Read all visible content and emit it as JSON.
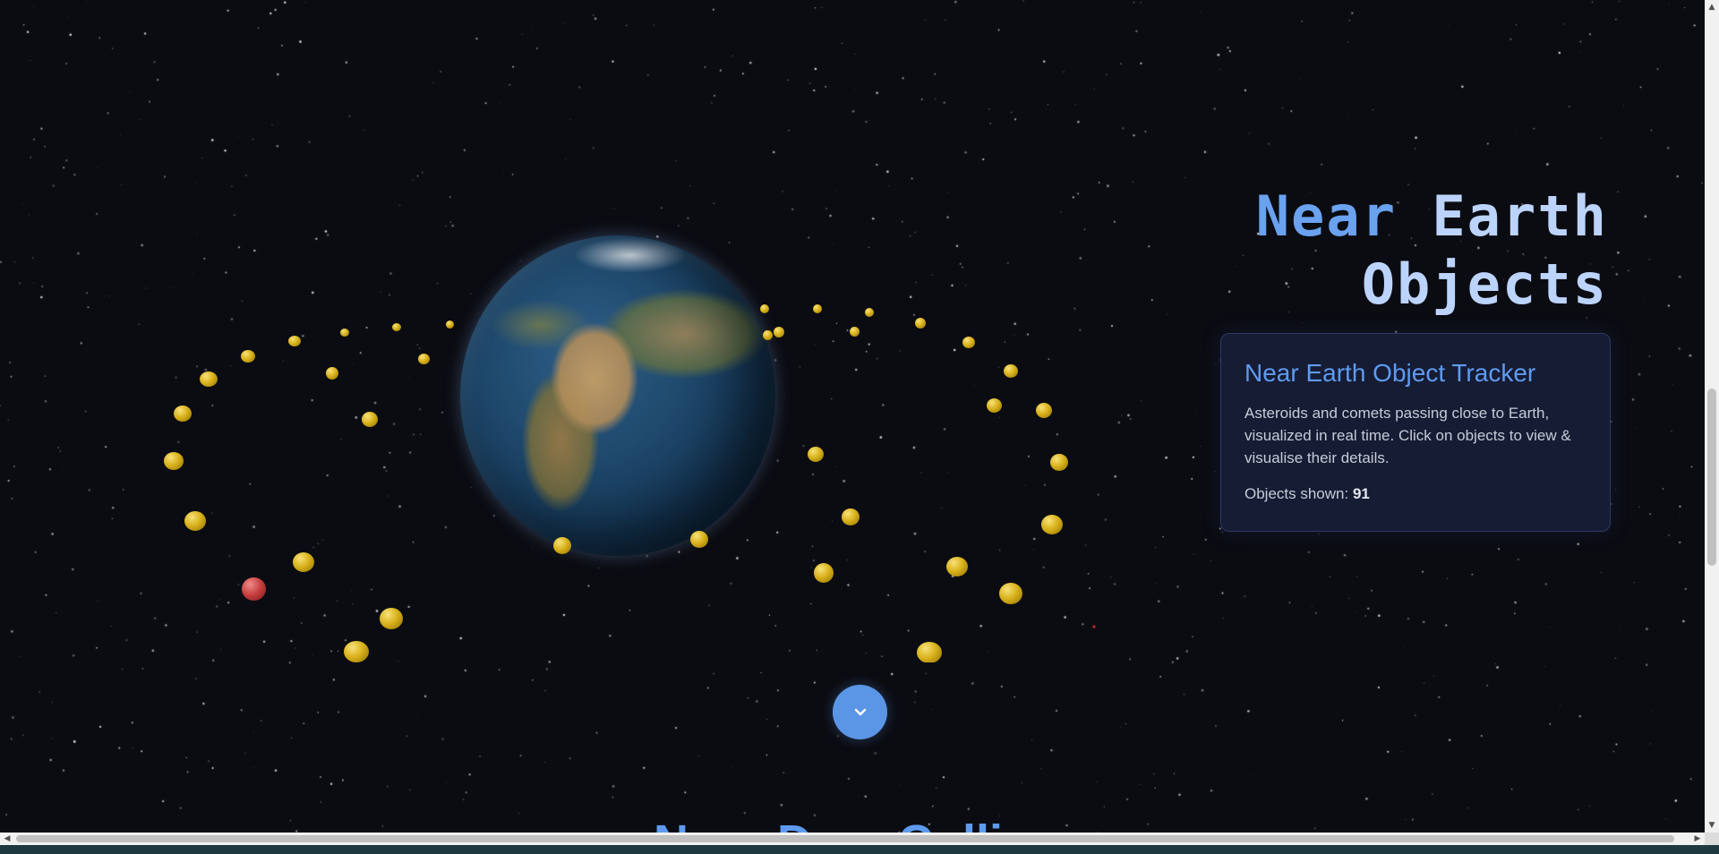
{
  "hero": {
    "title_line1_word1": "Near",
    "title_line1_word2": "Earth",
    "title_line2": "Objects"
  },
  "info_card": {
    "heading": "Near Earth Object Tracker",
    "description": "Asteroids and comets passing close to Earth, visualized in real time. Click on objects to view & visualise their details.",
    "count_label": "Objects shown:",
    "count_value": "91"
  },
  "scroll_button": {
    "icon": "chevron-down-icon"
  },
  "next_section": {
    "heading": "Near-Dom Colli"
  },
  "colors": {
    "accent": "#5e9bf0",
    "hazardous": "#c43c3c",
    "normal": "#d9b21c",
    "background": "#0b0c12"
  }
}
